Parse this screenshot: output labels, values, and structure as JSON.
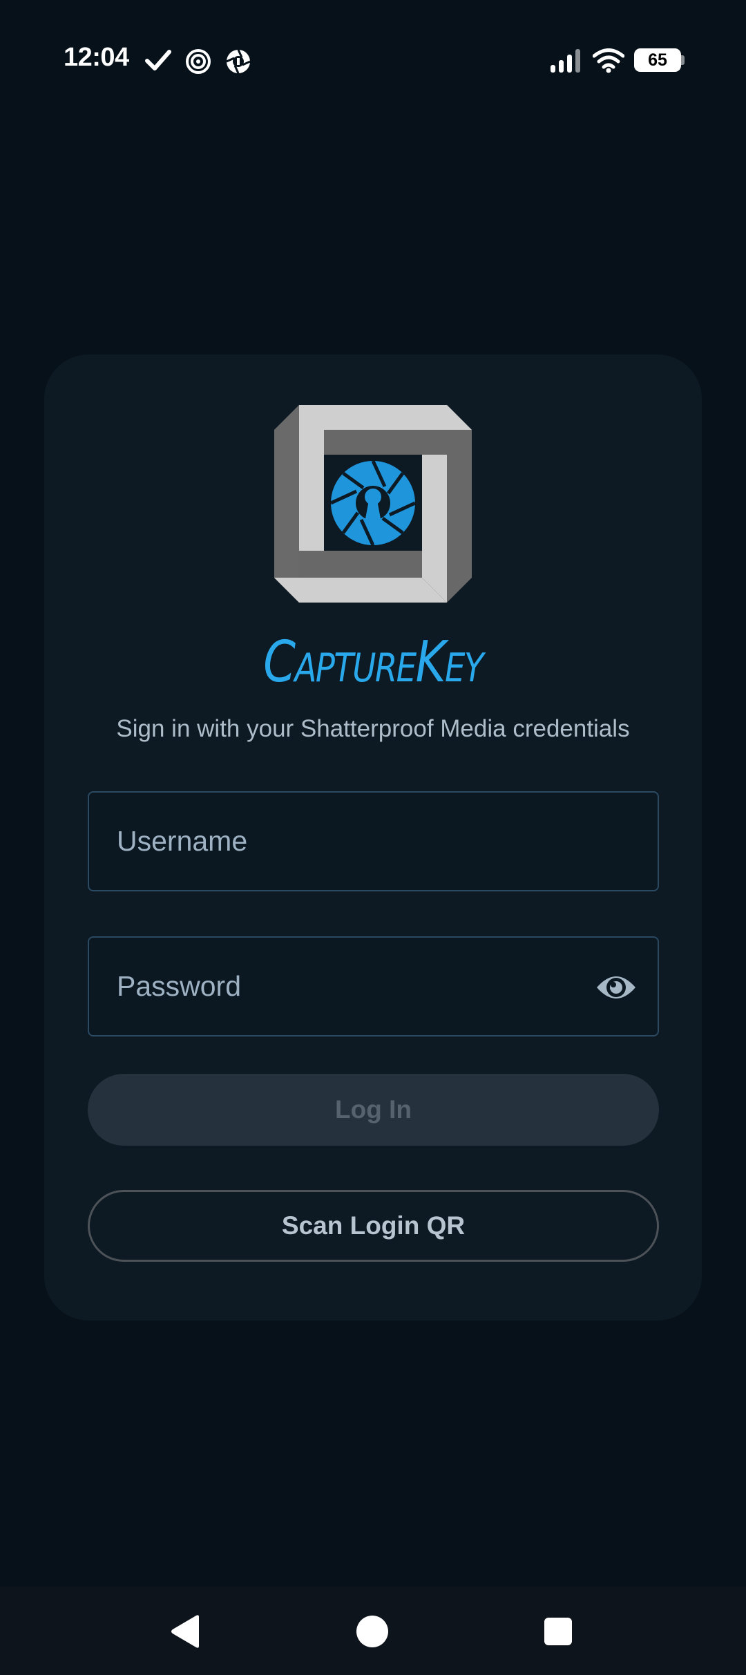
{
  "status_bar": {
    "time": "12:04",
    "battery_level": "65",
    "icons": [
      "check-icon",
      "spiral-app-icon",
      "aperture-app-icon",
      "signal-icon",
      "wifi-icon",
      "battery-icon"
    ]
  },
  "login": {
    "brand_name": "CaptureKey",
    "subtitle": "Sign in with your Shatterproof Media credentials",
    "username_placeholder": "Username",
    "username_value": "",
    "password_placeholder": "Password",
    "password_value": "",
    "login_label": "Log In",
    "qr_label": "Scan Login QR"
  },
  "colors": {
    "background": "#06111a",
    "card": "#0d1923",
    "accent": "#29a9ec",
    "field_border": "#2b4a62",
    "disabled_button": "#25323d"
  },
  "nav_bar": {
    "icons": [
      "back-icon",
      "home-icon",
      "recents-icon"
    ]
  }
}
